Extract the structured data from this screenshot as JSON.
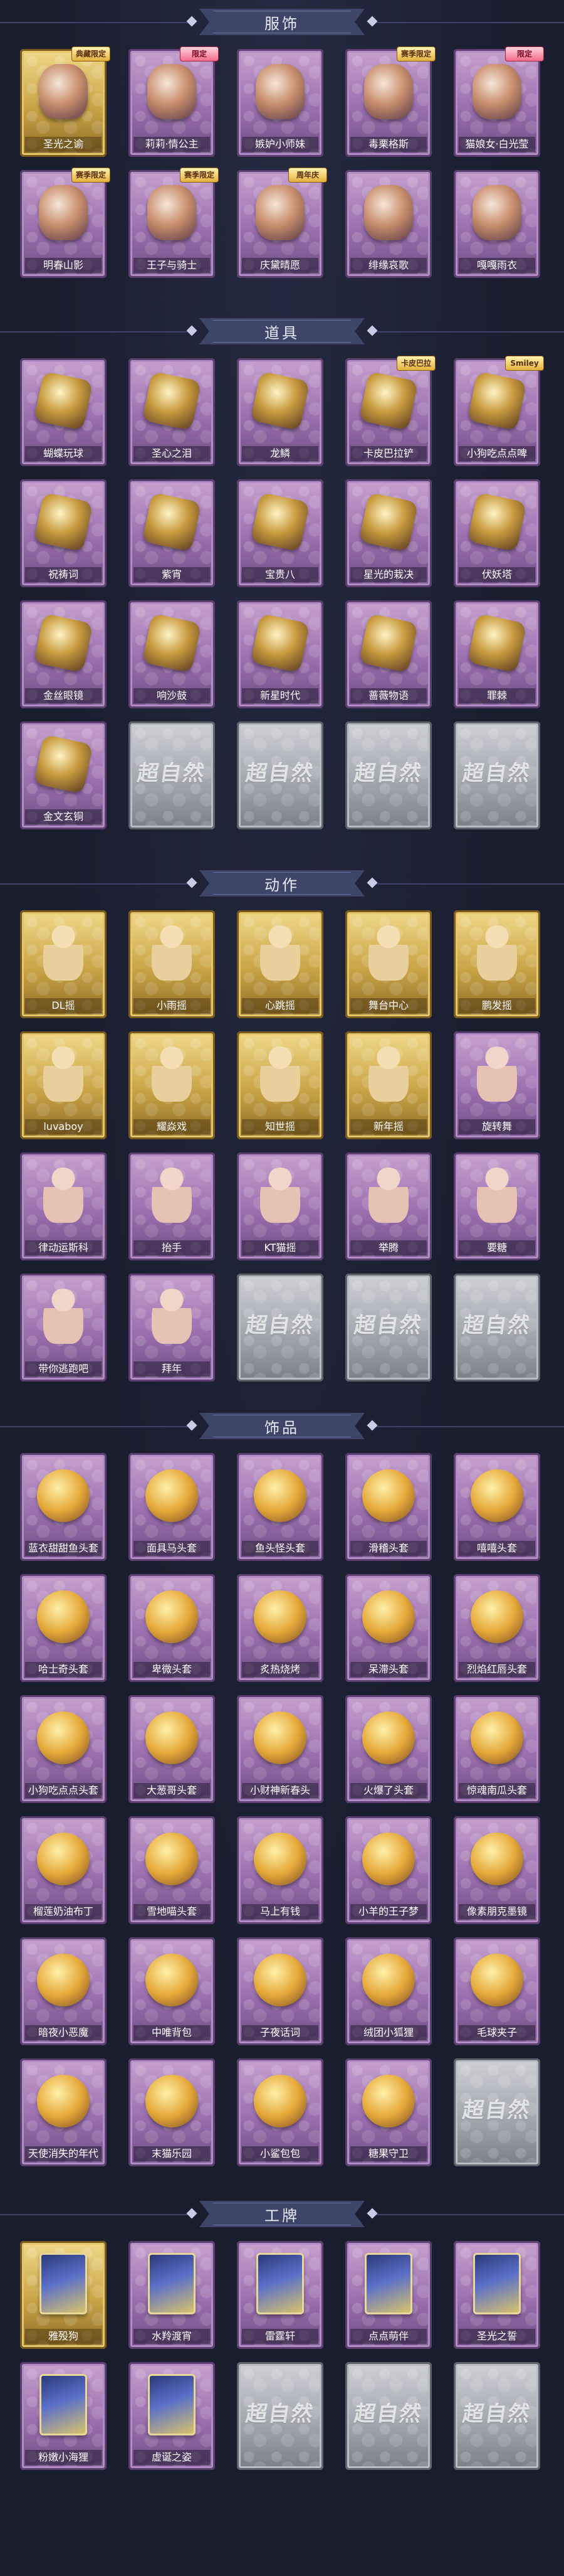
{
  "sections": [
    {
      "title": "服饰",
      "items": [
        {
          "name": "圣光之谕",
          "type": "outfit",
          "rarity": "gold",
          "badge": "典藏限定",
          "badge_style": "gold"
        },
        {
          "name": "莉莉·情公主",
          "type": "outfit",
          "rarity": "purple",
          "badge": "限定",
          "badge_style": "pink"
        },
        {
          "name": "嫉妒小师妹",
          "type": "outfit",
          "rarity": "purple",
          "badge": "",
          "badge_style": ""
        },
        {
          "name": "毒栗格斯",
          "type": "outfit",
          "rarity": "purple",
          "badge": "赛季限定",
          "badge_style": "gold"
        },
        {
          "name": "猫娘女·白光莹",
          "type": "outfit",
          "rarity": "purple",
          "badge": "限定",
          "badge_style": "pink"
        },
        {
          "name": "明春山影",
          "type": "outfit",
          "rarity": "purple",
          "badge": "赛季限定",
          "badge_style": "gold"
        },
        {
          "name": "王子与骑士",
          "type": "outfit",
          "rarity": "purple",
          "badge": "赛季限定",
          "badge_style": "gold"
        },
        {
          "name": "庆黛晴愿",
          "type": "outfit",
          "rarity": "purple",
          "badge": "周年庆",
          "badge_style": "gold"
        },
        {
          "name": "绯缘哀歌",
          "type": "outfit",
          "rarity": "purple",
          "badge": "",
          "badge_style": ""
        },
        {
          "name": "嘎嘎雨衣",
          "type": "outfit",
          "rarity": "purple",
          "badge": "",
          "badge_style": ""
        }
      ]
    },
    {
      "title": "道具",
      "items": [
        {
          "name": "蝴蝶玩球",
          "type": "item",
          "rarity": "purple",
          "badge": "",
          "badge_style": ""
        },
        {
          "name": "圣心之泪",
          "type": "item",
          "rarity": "purple",
          "badge": "",
          "badge_style": ""
        },
        {
          "name": "龙鳞",
          "type": "item",
          "rarity": "purple",
          "badge": "",
          "badge_style": ""
        },
        {
          "name": "卡皮巴拉铲",
          "type": "item",
          "rarity": "purple",
          "badge": "卡皮巴拉",
          "badge_style": "gold"
        },
        {
          "name": "小狗吃点点啤",
          "type": "item",
          "rarity": "purple",
          "badge": "Smiley",
          "badge_style": "gold"
        },
        {
          "name": "祝祷词",
          "type": "item",
          "rarity": "purple",
          "badge": "",
          "badge_style": ""
        },
        {
          "name": "紫宵",
          "type": "item",
          "rarity": "purple",
          "badge": "",
          "badge_style": ""
        },
        {
          "name": "宝贵八",
          "type": "item",
          "rarity": "purple",
          "badge": "",
          "badge_style": ""
        },
        {
          "name": "星光的栽决",
          "type": "item",
          "rarity": "purple",
          "badge": "",
          "badge_style": ""
        },
        {
          "name": "伏妖塔",
          "type": "item",
          "rarity": "purple",
          "badge": "",
          "badge_style": ""
        },
        {
          "name": "金丝眼镜",
          "type": "item",
          "rarity": "purple",
          "badge": "",
          "badge_style": ""
        },
        {
          "name": "响沙鼓",
          "type": "item",
          "rarity": "purple",
          "badge": "",
          "badge_style": ""
        },
        {
          "name": "新星时代",
          "type": "item",
          "rarity": "purple",
          "badge": "",
          "badge_style": ""
        },
        {
          "name": "蔷薇物语",
          "type": "item",
          "rarity": "purple",
          "badge": "",
          "badge_style": ""
        },
        {
          "name": "罪棘",
          "type": "item",
          "rarity": "purple",
          "badge": "",
          "badge_style": ""
        },
        {
          "name": "金文玄铜",
          "type": "item",
          "rarity": "purple",
          "badge": "",
          "badge_style": ""
        },
        {
          "name": "",
          "type": "empty",
          "rarity": "gray",
          "badge": "",
          "badge_style": ""
        },
        {
          "name": "",
          "type": "empty",
          "rarity": "gray",
          "badge": "",
          "badge_style": ""
        },
        {
          "name": "",
          "type": "empty",
          "rarity": "gray",
          "badge": "",
          "badge_style": ""
        },
        {
          "name": "",
          "type": "empty",
          "rarity": "gray",
          "badge": "",
          "badge_style": ""
        }
      ]
    },
    {
      "title": "动作",
      "items": [
        {
          "name": "DL摇",
          "type": "emote",
          "rarity": "gold",
          "badge": "",
          "badge_style": ""
        },
        {
          "name": "小雨摇",
          "type": "emote",
          "rarity": "gold",
          "badge": "",
          "badge_style": ""
        },
        {
          "name": "心跳摇",
          "type": "emote",
          "rarity": "gold",
          "badge": "",
          "badge_style": ""
        },
        {
          "name": "舞台中心",
          "type": "emote",
          "rarity": "gold",
          "badge": "",
          "badge_style": ""
        },
        {
          "name": "鹏发摇",
          "type": "emote",
          "rarity": "gold",
          "badge": "",
          "badge_style": ""
        },
        {
          "name": "luvaboy",
          "type": "emote",
          "rarity": "gold",
          "badge": "",
          "badge_style": ""
        },
        {
          "name": "耀焱戏",
          "type": "emote",
          "rarity": "gold",
          "badge": "",
          "badge_style": ""
        },
        {
          "name": "知世摇",
          "type": "emote",
          "rarity": "gold",
          "badge": "",
          "badge_style": ""
        },
        {
          "name": "新年摇",
          "type": "emote",
          "rarity": "gold",
          "badge": "",
          "badge_style": ""
        },
        {
          "name": "旋转舞",
          "type": "emote",
          "rarity": "purple",
          "badge": "",
          "badge_style": ""
        },
        {
          "name": "律动运斯科",
          "type": "emote",
          "rarity": "purple",
          "badge": "",
          "badge_style": ""
        },
        {
          "name": "抬手",
          "type": "emote",
          "rarity": "purple",
          "badge": "",
          "badge_style": ""
        },
        {
          "name": "KT猫摇",
          "type": "emote",
          "rarity": "purple",
          "badge": "",
          "badge_style": ""
        },
        {
          "name": "举腾",
          "type": "emote",
          "rarity": "purple",
          "badge": "",
          "badge_style": ""
        },
        {
          "name": "要糖",
          "type": "emote",
          "rarity": "purple",
          "badge": "",
          "badge_style": ""
        },
        {
          "name": "带你逃跑吧",
          "type": "emote",
          "rarity": "purple",
          "badge": "",
          "badge_style": ""
        },
        {
          "name": "拜年",
          "type": "emote",
          "rarity": "purple",
          "badge": "",
          "badge_style": ""
        },
        {
          "name": "",
          "type": "empty",
          "rarity": "gray",
          "badge": "",
          "badge_style": ""
        },
        {
          "name": "",
          "type": "empty",
          "rarity": "gray",
          "badge": "",
          "badge_style": ""
        },
        {
          "name": "",
          "type": "empty",
          "rarity": "gray",
          "badge": "",
          "badge_style": ""
        }
      ]
    },
    {
      "title": "饰品",
      "items": [
        {
          "name": "蓝衣甜甜鱼头套",
          "type": "acc",
          "rarity": "purple",
          "badge": "",
          "badge_style": ""
        },
        {
          "name": "面具马头套",
          "type": "acc",
          "rarity": "purple",
          "badge": "",
          "badge_style": ""
        },
        {
          "name": "鱼头怪头套",
          "type": "acc",
          "rarity": "purple",
          "badge": "",
          "badge_style": ""
        },
        {
          "name": "滑稽头套",
          "type": "acc",
          "rarity": "purple",
          "badge": "",
          "badge_style": ""
        },
        {
          "name": "嘻嘻头套",
          "type": "acc",
          "rarity": "purple",
          "badge": "",
          "badge_style": ""
        },
        {
          "name": "哈士奇头套",
          "type": "acc",
          "rarity": "purple",
          "badge": "",
          "badge_style": ""
        },
        {
          "name": "卑微头套",
          "type": "acc",
          "rarity": "purple",
          "badge": "",
          "badge_style": ""
        },
        {
          "name": "炙热烧烤",
          "type": "acc",
          "rarity": "purple",
          "badge": "",
          "badge_style": ""
        },
        {
          "name": "呆滞头套",
          "type": "acc",
          "rarity": "purple",
          "badge": "",
          "badge_style": ""
        },
        {
          "name": "烈焰红唇头套",
          "type": "acc",
          "rarity": "purple",
          "badge": "",
          "badge_style": ""
        },
        {
          "name": "小狗吃点点头套",
          "type": "acc",
          "rarity": "purple",
          "badge": "",
          "badge_style": ""
        },
        {
          "name": "大葱哥头套",
          "type": "acc",
          "rarity": "purple",
          "badge": "",
          "badge_style": ""
        },
        {
          "name": "小财神新春头",
          "type": "acc",
          "rarity": "purple",
          "badge": "",
          "badge_style": ""
        },
        {
          "name": "火爆了头套",
          "type": "acc",
          "rarity": "purple",
          "badge": "",
          "badge_style": ""
        },
        {
          "name": "惊魂南瓜头套",
          "type": "acc",
          "rarity": "purple",
          "badge": "",
          "badge_style": ""
        },
        {
          "name": "榴莲奶油布丁",
          "type": "acc",
          "rarity": "purple",
          "badge": "",
          "badge_style": ""
        },
        {
          "name": "雪地喵头套",
          "type": "acc",
          "rarity": "purple",
          "badge": "",
          "badge_style": ""
        },
        {
          "name": "马上有钱",
          "type": "acc",
          "rarity": "purple",
          "badge": "",
          "badge_style": ""
        },
        {
          "name": "小羊的王子梦",
          "type": "acc",
          "rarity": "purple",
          "badge": "",
          "badge_style": ""
        },
        {
          "name": "像素朋克墨镜",
          "type": "acc",
          "rarity": "purple",
          "badge": "",
          "badge_style": ""
        },
        {
          "name": "暗夜小恶魔",
          "type": "acc",
          "rarity": "purple",
          "badge": "",
          "badge_style": ""
        },
        {
          "name": "中唯背包",
          "type": "acc",
          "rarity": "purple",
          "badge": "",
          "badge_style": ""
        },
        {
          "name": "子夜话词",
          "type": "acc",
          "rarity": "purple",
          "badge": "",
          "badge_style": ""
        },
        {
          "name": "绒团小狐狸",
          "type": "acc",
          "rarity": "purple",
          "badge": "",
          "badge_style": ""
        },
        {
          "name": "毛球夹子",
          "type": "acc",
          "rarity": "purple",
          "badge": "",
          "badge_style": ""
        },
        {
          "name": "天使消失的年代",
          "type": "acc",
          "rarity": "purple",
          "badge": "",
          "badge_style": ""
        },
        {
          "name": "末猫乐园",
          "type": "acc",
          "rarity": "purple",
          "badge": "",
          "badge_style": ""
        },
        {
          "name": "小鲨包包",
          "type": "acc",
          "rarity": "purple",
          "badge": "",
          "badge_style": ""
        },
        {
          "name": "糖果守卫",
          "type": "acc",
          "rarity": "purple",
          "badge": "",
          "badge_style": ""
        },
        {
          "name": "",
          "type": "empty",
          "rarity": "gray",
          "badge": "",
          "badge_style": ""
        }
      ]
    },
    {
      "title": "工牌",
      "items": [
        {
          "name": "雅殁狗",
          "type": "card",
          "rarity": "gold",
          "badge": "",
          "badge_style": ""
        },
        {
          "name": "水羚渡宵",
          "type": "card",
          "rarity": "purple",
          "badge": "",
          "badge_style": ""
        },
        {
          "name": "雷霆轩",
          "type": "card",
          "rarity": "purple",
          "badge": "",
          "badge_style": ""
        },
        {
          "name": "点点萌伴",
          "type": "card",
          "rarity": "purple",
          "badge": "",
          "badge_style": ""
        },
        {
          "name": "圣光之誓",
          "type": "card",
          "rarity": "purple",
          "badge": "",
          "badge_style": ""
        },
        {
          "name": "粉嫩小海狸",
          "type": "card",
          "rarity": "purple",
          "badge": "",
          "badge_style": ""
        },
        {
          "name": "虚诞之姿",
          "type": "card",
          "rarity": "purple",
          "badge": "",
          "badge_style": ""
        },
        {
          "name": "",
          "type": "empty",
          "rarity": "gray",
          "badge": "",
          "badge_style": ""
        },
        {
          "name": "",
          "type": "empty",
          "rarity": "gray",
          "badge": "",
          "badge_style": ""
        },
        {
          "name": "",
          "type": "empty",
          "rarity": "gray",
          "badge": "",
          "badge_style": ""
        }
      ]
    }
  ],
  "empty_slot_logo": "超自然",
  "colors": {
    "background": "#1a1d2e",
    "ribbon": "#3d4568",
    "purple_frame": "#9a6fae",
    "gold_frame": "#c9a446",
    "gray_frame": "#9fa3ab"
  }
}
